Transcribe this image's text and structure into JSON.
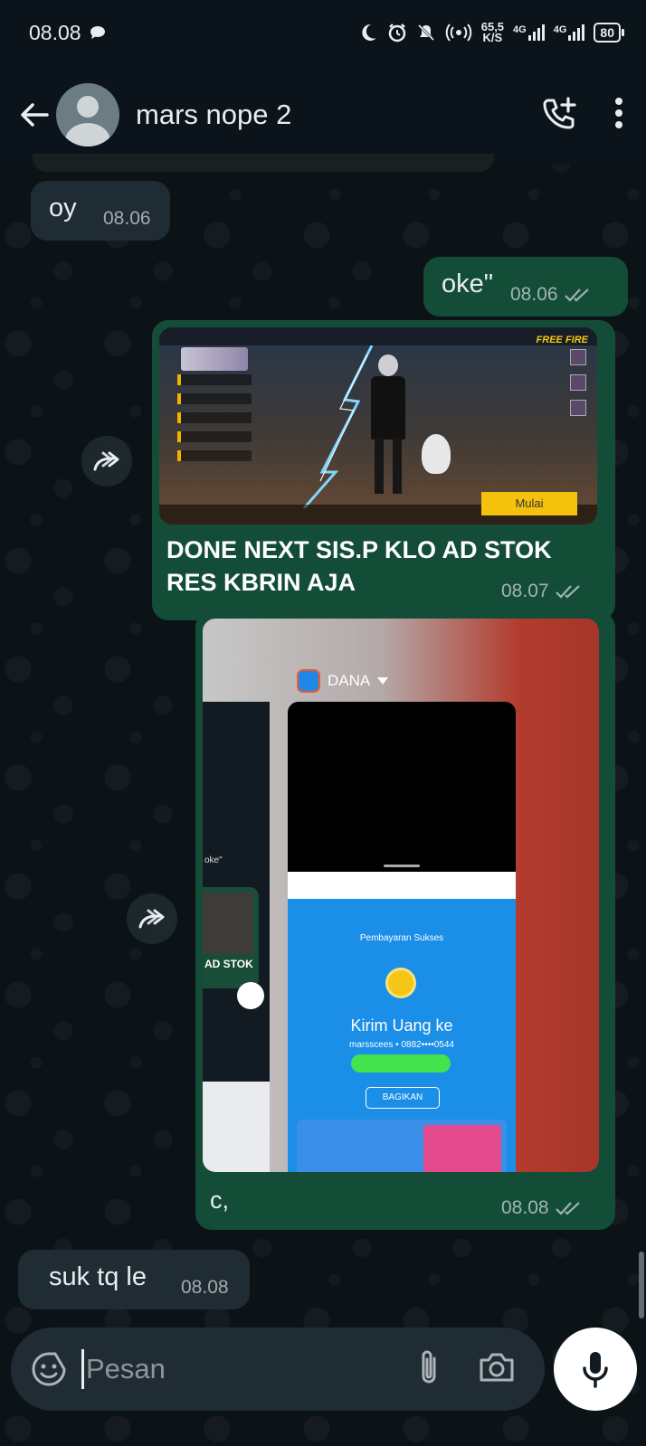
{
  "status_bar": {
    "time": "08.08",
    "net_speed_value": "65,5",
    "net_speed_unit": "K/S",
    "sim1_label": "4G",
    "sim2_label": "4G",
    "battery": "80"
  },
  "header": {
    "contact_name": "mars nope 2"
  },
  "messages": {
    "m1": {
      "text": "oy",
      "time": "08.06"
    },
    "m2": {
      "text": "oke\"",
      "time": "08.06"
    },
    "m3": {
      "caption": "DONE NEXT SIS.P KLO AD STOK RES KBRIN AJA",
      "time": "08.07"
    },
    "m4": {
      "caption": "c,",
      "time": "08.08"
    },
    "m5": {
      "text": "suk tq le",
      "time": "08.08"
    }
  },
  "game_screenshot": {
    "brand": "FREE FIRE",
    "start_button": "Mulai"
  },
  "dana_screenshot": {
    "app_name": "DANA",
    "status_title": "Pembayaran Sukses",
    "headline": "Kirim Uang ke",
    "account": "marsscees • 0882••••0544",
    "share_button": "BAGIKAN",
    "prev_chat_oke": "oke\"",
    "prev_chat_caption": "AD STOK"
  },
  "composer": {
    "placeholder": "Pesan"
  },
  "icons": {
    "back": "arrow-left-icon",
    "call": "add-call-icon",
    "menu": "more-vertical-icon",
    "forward": "forward-icon",
    "emoji": "sticker-icon",
    "attach": "paperclip-icon",
    "camera": "camera-icon",
    "mic": "mic-icon"
  }
}
